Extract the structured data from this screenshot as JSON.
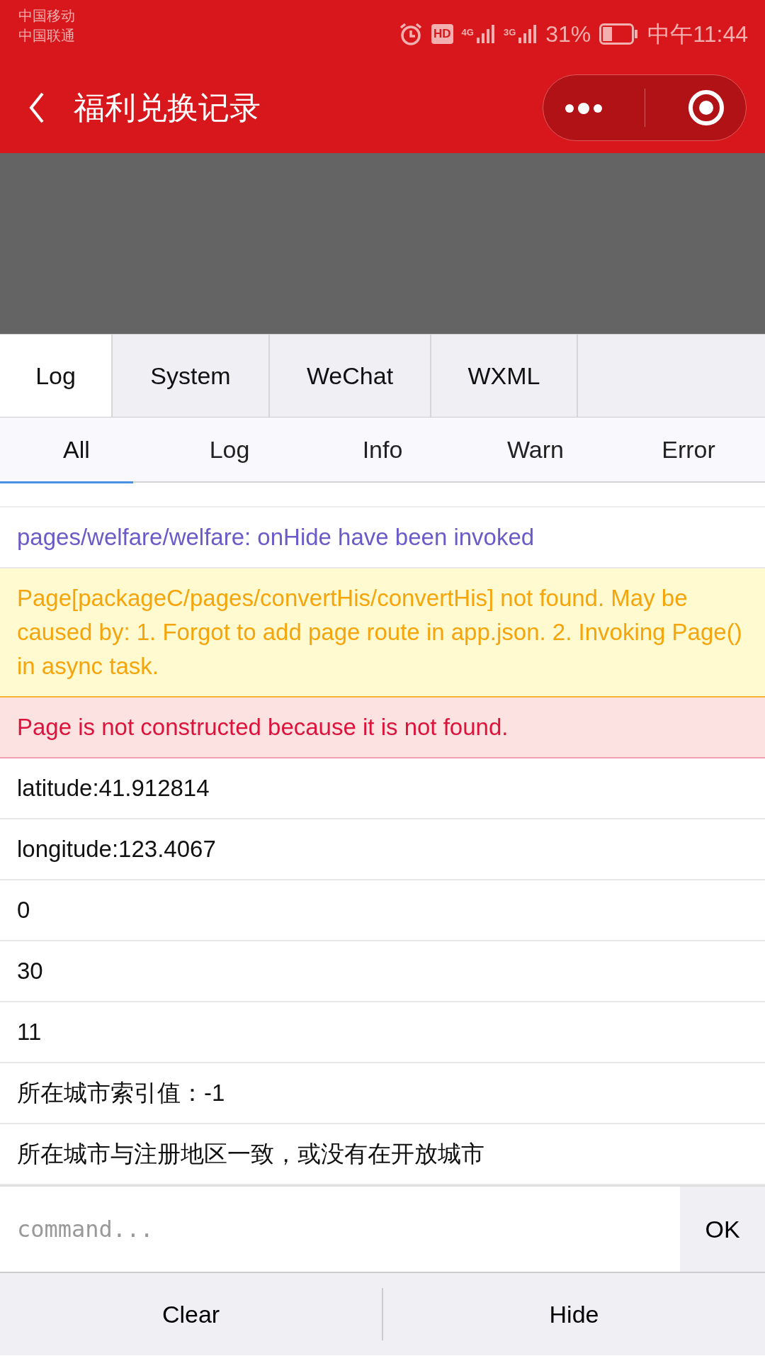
{
  "status_bar": {
    "carriers": [
      "中国移动",
      "中国联通"
    ],
    "hd": "HD",
    "network_1": "4G",
    "network_2": "3G",
    "battery": "31%",
    "time": "中午11:44"
  },
  "nav_bar": {
    "title": "福利兑换记录"
  },
  "tabs": [
    {
      "label": "Log",
      "selected": true
    },
    {
      "label": "System",
      "selected": false
    },
    {
      "label": "WeChat",
      "selected": false
    },
    {
      "label": "WXML",
      "selected": false
    }
  ],
  "filters": [
    {
      "label": "All",
      "selected": true
    },
    {
      "label": "Log",
      "selected": false
    },
    {
      "label": "Info",
      "selected": false
    },
    {
      "label": "Warn",
      "selected": false
    },
    {
      "label": "Error",
      "selected": false
    }
  ],
  "logs": [
    {
      "kind": "info",
      "text": "pages/welfare/welfare: onHide have been invoked"
    },
    {
      "kind": "warn",
      "text": "Page[packageC/pages/convertHis/convertHis] not found. May be caused by: 1. Forgot to add page route in app.json. 2. Invoking Page() in async task."
    },
    {
      "kind": "error",
      "text": "Page is not constructed because it is not found."
    },
    {
      "kind": "log",
      "text": "latitude:41.912814"
    },
    {
      "kind": "log",
      "text": "longitude:123.4067"
    },
    {
      "kind": "log",
      "text": "0"
    },
    {
      "kind": "log",
      "text": "30"
    },
    {
      "kind": "log",
      "text": "11"
    },
    {
      "kind": "log",
      "text": "所在城市索引值：-1"
    },
    {
      "kind": "log",
      "text": "所在城市与注册地区一致，或没有在开放城市"
    }
  ],
  "command": {
    "placeholder": "command...",
    "button": "OK"
  },
  "bottom_buttons": [
    "Clear",
    "Hide"
  ]
}
